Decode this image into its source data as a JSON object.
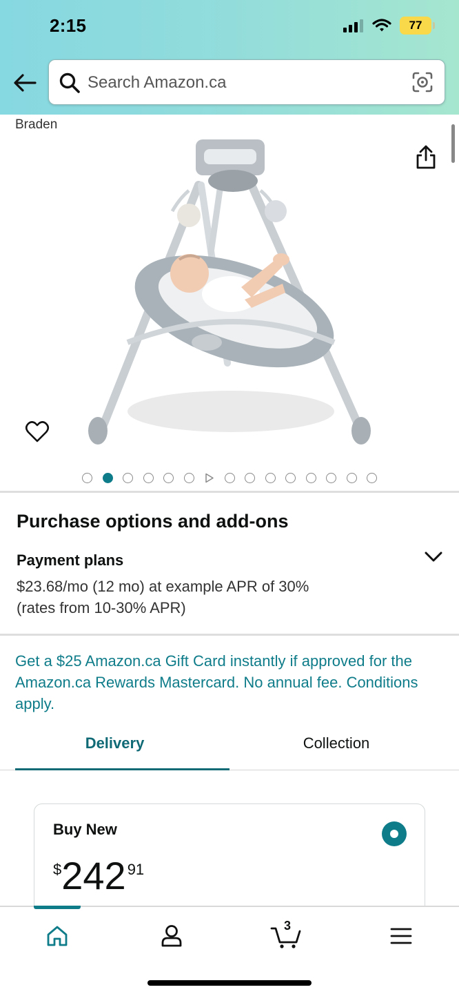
{
  "status_bar": {
    "time": "2:15",
    "battery": "77"
  },
  "search": {
    "placeholder": "Search Amazon.ca"
  },
  "product": {
    "brand": "Braden",
    "image_count": 15,
    "active_image_index": 1,
    "video_dot_index": 6
  },
  "purchase_options": {
    "title": "Purchase options and add-ons",
    "payment_plans_title": "Payment plans",
    "payment_plans_line1": "$23.68/mo (12 mo) at example APR of 30%",
    "payment_plans_line2": "(rates from 10-30% APR)"
  },
  "promo": {
    "text": "Get a $25 Amazon.ca Gift Card instantly if approved for the Amazon.ca Rewards Mastercard. No annual fee. Conditions apply."
  },
  "tabs": {
    "delivery": "Delivery",
    "collection": "Collection",
    "active": "delivery"
  },
  "buy_box": {
    "label": "Buy New",
    "currency": "$",
    "price_whole": "242",
    "price_fraction": "91",
    "selected": true
  },
  "bottom_nav": {
    "items": [
      "home-icon",
      "account-icon",
      "cart-icon",
      "menu-icon"
    ],
    "cart_count": "3",
    "active": "home"
  },
  "colors": {
    "accent": "#0f7c8a",
    "promo_text": "#0f7c8a",
    "battery": "#f9d949"
  }
}
